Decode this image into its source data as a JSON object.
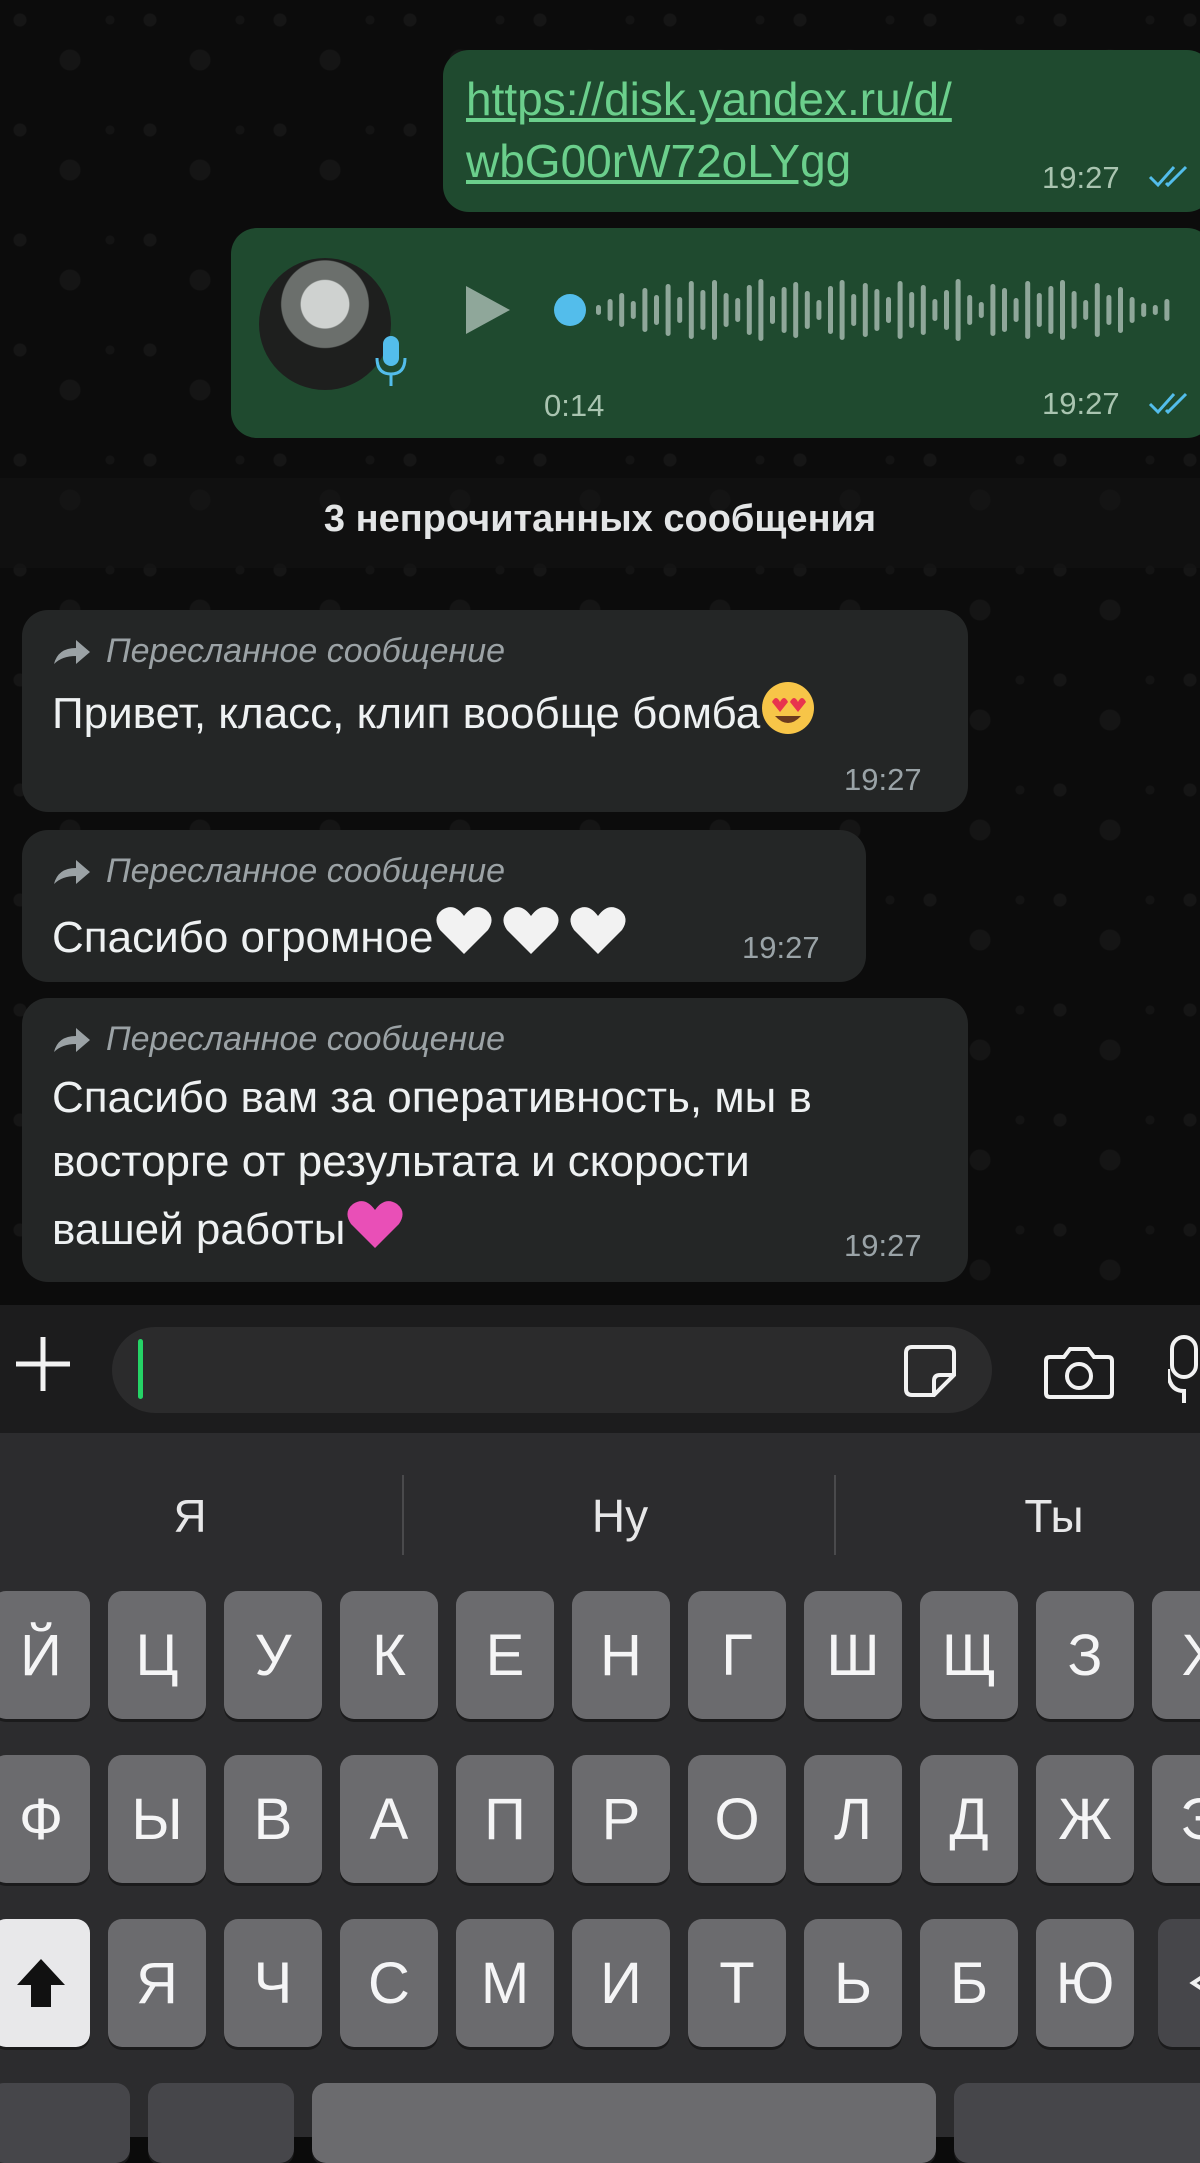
{
  "messages": {
    "link": {
      "line1": "https://disk.yandex.ru/d/",
      "line2": "wbG00rW72oLYgg",
      "time": "19:27"
    },
    "voice": {
      "duration": "0:14",
      "time": "19:27"
    },
    "unread_label": "3 непрочитанных сообщения",
    "incoming": [
      {
        "forwarded": "Пересланное сообщение",
        "text": "Привет, класс, клип вообще бомба",
        "emoji": "heart-eyes",
        "time": "19:27"
      },
      {
        "forwarded": "Пересланное сообщение",
        "text": "Спасибо огромное",
        "emoji": "white-hearts",
        "time": "19:27"
      },
      {
        "forwarded": "Пересланное сообщение",
        "line1": "Спасибо вам за оперативность, мы в",
        "line2": "восторге от результата и скорости",
        "line3": "вашей работы",
        "emoji": "pink-heart",
        "time": "19:27"
      }
    ]
  },
  "colors": {
    "outgoing_bubble": "#1f4a2f",
    "incoming_bubble": "#242626",
    "link": "#6bcf8c",
    "ticks": "#53bdeb",
    "caret": "#25d366"
  },
  "keyboard": {
    "suggestions": [
      "Я",
      "Ну",
      "Ты"
    ],
    "row1": [
      "Й",
      "Ц",
      "У",
      "К",
      "Е",
      "Н",
      "Г",
      "Ш",
      "Щ",
      "З",
      "Х"
    ],
    "row2": [
      "Ф",
      "Ы",
      "В",
      "А",
      "П",
      "Р",
      "О",
      "Л",
      "Д",
      "Ж",
      "Э"
    ],
    "row3": [
      "Я",
      "Ч",
      "С",
      "М",
      "И",
      "Т",
      "Ь",
      "Б",
      "Ю"
    ]
  }
}
